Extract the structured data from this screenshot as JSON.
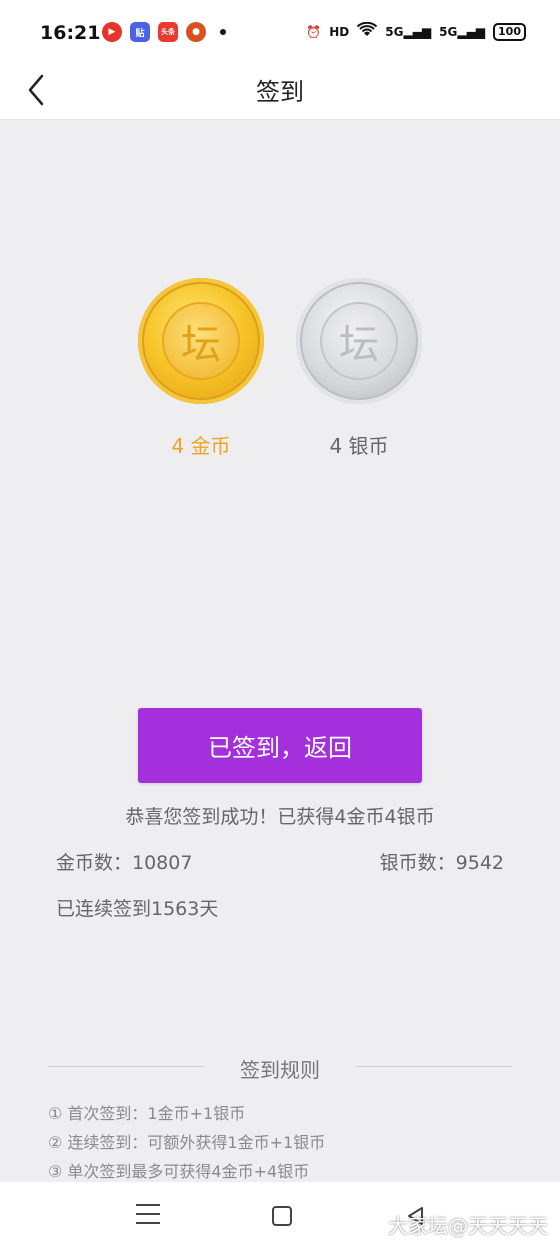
{
  "status_bar": {
    "time": "16:21",
    "apps": [
      {
        "icon": "video-app-icon",
        "text": "",
        "color": "#e8332a"
      },
      {
        "icon": "tieba-app-icon",
        "text": "贴",
        "color": "#4a62e8"
      },
      {
        "icon": "toutiao-app-icon",
        "text": "头条",
        "color": "#e63b2e"
      },
      {
        "icon": "orange-app-icon",
        "text": "",
        "color": "#d8531b"
      }
    ],
    "indicators": [
      "HD",
      "5G",
      "5G"
    ],
    "battery": "100"
  },
  "header": {
    "title": "签到"
  },
  "coins": {
    "gold_glyph": "坛",
    "silver_glyph": "坛",
    "gold_label": "4 金币",
    "silver_label": "4 银币"
  },
  "action": {
    "button_label": "已签到，返回"
  },
  "result": {
    "message": "恭喜您签到成功！已获得4金币4银币",
    "gold_total": "金币数：10807",
    "silver_total": "银币数：9542",
    "streak": "已连续签到1563天"
  },
  "rules": {
    "title": "签到规则",
    "items": [
      "① 首次签到：1金币+1银币",
      "② 连续签到：可额外获得1金币+1银币",
      "③ 单次签到最多可获得4金币+4银币"
    ]
  },
  "watermark": "大家坛@天天天天",
  "colors": {
    "accent_button": "#a430dd",
    "gold_text": "#f0a322",
    "background": "#eeeef1"
  }
}
